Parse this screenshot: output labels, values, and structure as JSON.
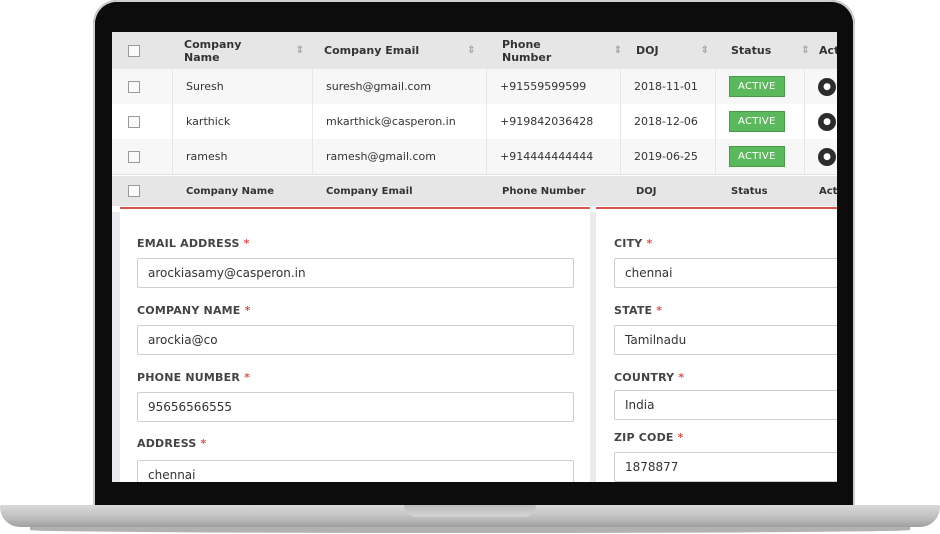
{
  "table": {
    "headers": [
      "Company Name",
      "Company Email",
      "Phone Number",
      "DOJ",
      "Status",
      "Acti"
    ],
    "sort_icon": "⇕",
    "rows": [
      {
        "name": "Suresh",
        "email": "suresh@gmail.com",
        "phone": "+91559599599",
        "doj": "2018-11-01",
        "status": "ACTIVE"
      },
      {
        "name": "karthick",
        "email": "mkarthick@casperon.in",
        "phone": "+919842036428",
        "doj": "2018-12-06",
        "status": "ACTIVE"
      },
      {
        "name": "ramesh",
        "email": "ramesh@gmail.com",
        "phone": "+914444444444",
        "doj": "2019-06-25",
        "status": "ACTIVE"
      }
    ],
    "footer": [
      "Company Name",
      "Company Email",
      "Phone Number",
      "DOJ",
      "Status",
      "Acti"
    ],
    "status_color": "#5cb85c"
  },
  "form_left": {
    "fields": [
      {
        "label": "EMAIL ADDRESS",
        "value": "arockiasamy@casperon.in"
      },
      {
        "label": "COMPANY NAME",
        "value": "arockia@co"
      },
      {
        "label": "PHONE NUMBER",
        "value": "95656566555"
      },
      {
        "label": "ADDRESS",
        "value": "chennai"
      }
    ]
  },
  "form_right": {
    "fields": [
      {
        "label": "CITY",
        "value": "chennai"
      },
      {
        "label": "STATE",
        "value": "Tamilnadu"
      },
      {
        "label": "COUNTRY",
        "value": "India"
      },
      {
        "label": "ZIP CODE",
        "value": "1878877"
      }
    ]
  },
  "required_mark": "*",
  "accent_color": "#d9534f"
}
